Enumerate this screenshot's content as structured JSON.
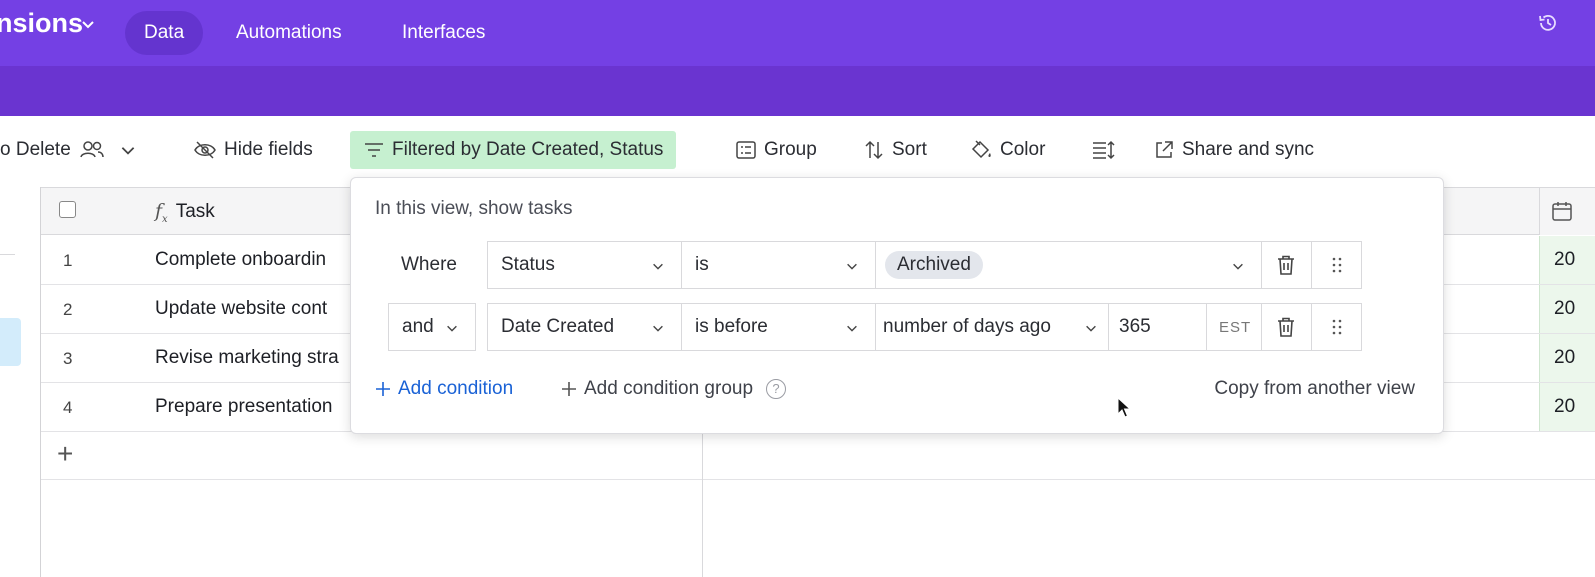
{
  "app": {
    "base_name": "nsions",
    "nav_tabs": [
      {
        "label": "Data",
        "active": true
      },
      {
        "label": "Automations",
        "active": false
      },
      {
        "label": "Interfaces",
        "active": false
      }
    ]
  },
  "toolbar": {
    "view_name": "o Delete",
    "hide_fields": "Hide fields",
    "filter": "Filtered by Date Created, Status",
    "group": "Group",
    "sort": "Sort",
    "color": "Color",
    "share": "Share and sync"
  },
  "grid": {
    "task_header": "Task",
    "rows": [
      {
        "num": "1",
        "task": "Complete onboardin",
        "date": "20"
      },
      {
        "num": "2",
        "task": "Update website cont",
        "date": "20"
      },
      {
        "num": "3",
        "task": "Revise marketing stra",
        "date": "20"
      },
      {
        "num": "4",
        "task": "Prepare presentation",
        "date": "20"
      }
    ],
    "add_row_symbol": "+"
  },
  "filter_popover": {
    "title": "In this view, show tasks",
    "conditions": [
      {
        "conjunction": "Where",
        "field": "Status",
        "operator": "is",
        "value": "Archived"
      },
      {
        "conjunction": "and",
        "field": "Date Created",
        "operator": "is before",
        "mode": "number of days ago",
        "value": "365",
        "timezone": "EST"
      }
    ],
    "add_condition": "Add condition",
    "add_condition_group": "Add condition group",
    "help_symbol": "?",
    "copy_from_view": "Copy from another view"
  },
  "colors": {
    "topbar": "#7440e4",
    "filter_active_bg": "#c6f0d0",
    "link_blue": "#1a62d6"
  }
}
